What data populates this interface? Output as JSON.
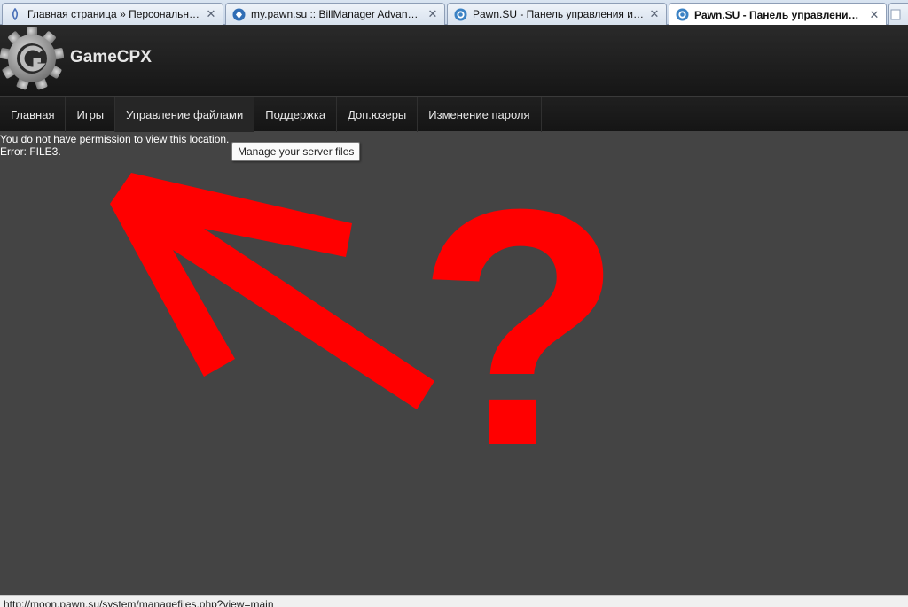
{
  "browser": {
    "tabs": [
      {
        "title": "Главная страница » Персональны...",
        "icon": "forum-favicon",
        "active": false
      },
      {
        "title": "my.pawn.su :: BillManager Advance...",
        "icon": "billmanager-favicon",
        "active": false
      },
      {
        "title": "Pawn.SU - Панель управления игр...",
        "icon": "gamecpx-favicon",
        "active": false
      },
      {
        "title": "Pawn.SU - Панель управления и...",
        "icon": "gamecpx-favicon",
        "active": true
      }
    ],
    "close_glyph": "✕"
  },
  "header": {
    "brand": "GameCPX",
    "logo_icon": "gear-logo-icon"
  },
  "nav": {
    "items": [
      {
        "label": "Главная"
      },
      {
        "label": "Игры"
      },
      {
        "label": "Управление файлами"
      },
      {
        "label": "Поддержка"
      },
      {
        "label": "Доп.юзеры"
      },
      {
        "label": "Изменение пароля"
      }
    ]
  },
  "content": {
    "error_line1": "You do not have permission to view this location.",
    "error_line2": "Error: FILE3.",
    "tooltip": "Manage your server files",
    "annotation_text": "?",
    "annotation_color": "#ff0000"
  },
  "statusbar": {
    "url": "http://moon.pawn.su/system/managefiles.php?view=main"
  },
  "colors": {
    "background": "#444444",
    "header_dark": "#161616",
    "text_light": "#e8e8e8"
  }
}
